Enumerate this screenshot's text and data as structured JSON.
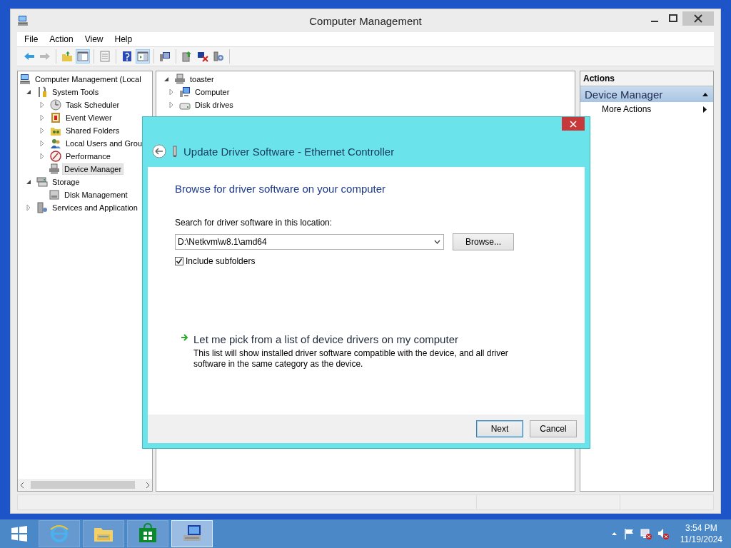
{
  "window": {
    "title": "Computer Management"
  },
  "menu": [
    "File",
    "Action",
    "View",
    "Help"
  ],
  "toolbar": {
    "groups": [
      {
        "buttons": [
          {
            "kind": "back",
            "disabled": false
          },
          {
            "kind": "forward",
            "disabled": true
          }
        ]
      },
      {
        "buttons": [
          {
            "kind": "up-folder",
            "pressed": false
          },
          {
            "kind": "console-tree",
            "pressed": true
          }
        ]
      },
      {
        "buttons": [
          {
            "kind": "properties",
            "pressed": false
          }
        ]
      },
      {
        "buttons": [
          {
            "kind": "help",
            "pressed": false
          },
          {
            "kind": "action-pane",
            "pressed": true
          }
        ]
      },
      {
        "buttons": [
          {
            "kind": "scan",
            "pressed": false
          }
        ]
      },
      {
        "buttons": [
          {
            "kind": "update-driver",
            "pressed": false
          },
          {
            "kind": "uninstall",
            "pressed": false
          },
          {
            "kind": "add-hardware",
            "pressed": false
          }
        ]
      }
    ]
  },
  "console_tree": [
    {
      "label": "Computer Management (Local",
      "kind": "computer",
      "selected": false,
      "children": [
        {
          "label": "System Tools",
          "kind": "tools",
          "expanded": true,
          "selected": false,
          "children": [
            {
              "label": "Task Scheduler",
              "kind": "clock",
              "expanded": false,
              "selected": false
            },
            {
              "label": "Event Viewer",
              "kind": "event",
              "expanded": false,
              "selected": false
            },
            {
              "label": "Shared Folders",
              "kind": "folder",
              "expanded": false,
              "selected": false
            },
            {
              "label": "Local Users and Grou",
              "kind": "users",
              "expanded": false,
              "selected": false
            },
            {
              "label": "Performance",
              "kind": "performance",
              "expanded": false,
              "selected": false
            },
            {
              "label": "Device Manager",
              "kind": "device",
              "selected": true
            }
          ]
        },
        {
          "label": "Storage",
          "kind": "storage",
          "expanded": true,
          "selected": false,
          "children": [
            {
              "label": "Disk Management",
              "kind": "disk",
              "selected": false
            }
          ]
        },
        {
          "label": "Services and Application",
          "kind": "services",
          "expanded": false,
          "selected": false
        }
      ]
    }
  ],
  "device_tree": [
    {
      "label": "toaster",
      "kind": "device",
      "expanded": true,
      "selected": false,
      "children": [
        {
          "label": "Computer",
          "kind": "monitor",
          "expanded": false,
          "selected": false
        },
        {
          "label": "Disk drives",
          "kind": "drive",
          "expanded": false,
          "selected": false
        }
      ]
    }
  ],
  "actions": {
    "header": "Actions",
    "section": "Device Manager",
    "items": [
      "More Actions"
    ]
  },
  "dialog": {
    "title": "Update Driver Software - Ethernet Controller",
    "heading": "Browse for driver software on your computer",
    "location_label": "Search for driver software in this location:",
    "location": "D:\\Netkvm\\w8.1\\amd64",
    "browse_button": "Browse...",
    "include_subfolders": {
      "label": "Include subfolders",
      "checked": true
    },
    "pick_option": {
      "title": "Let me pick from a list of device drivers on my computer",
      "description": "This list will show installed driver software compatible with the device, and all driver software in the same category as the device."
    },
    "buttons": [
      {
        "label": "Next",
        "default": true
      },
      {
        "label": "Cancel",
        "default": false
      }
    ]
  },
  "taskbar": {
    "apps": [
      {
        "kind": "browser",
        "active": false
      },
      {
        "kind": "explorer",
        "active": false
      },
      {
        "kind": "store",
        "active": false
      },
      {
        "kind": "computer-management",
        "active": true
      }
    ],
    "time": "3:54 PM",
    "date": "11/19/2024"
  }
}
